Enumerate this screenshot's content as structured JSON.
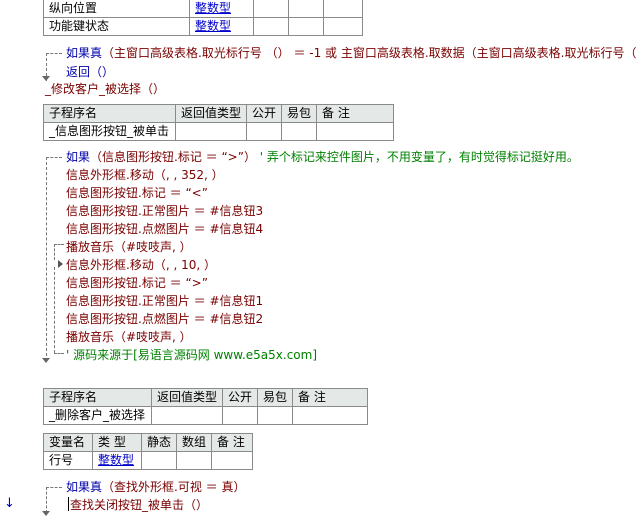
{
  "table_top": {
    "rows": [
      {
        "name": "纵向位置",
        "type": "整数型"
      },
      {
        "name": "功能键状态",
        "type": "整数型"
      }
    ]
  },
  "code1": {
    "if_kw": "如果真",
    "if_cond": "（主窗口高级表格.取光标行号 （） ＝ -1 或 主窗口高级表格.取数据（主窗口高级表格.取光标行号（",
    "ret": "返回（）",
    "sub_name": "_修改客户_被选择（）"
  },
  "sub_table_1": {
    "headers": [
      "子程序名",
      "返回值类型",
      "公开",
      "易包",
      "备 注"
    ],
    "name": "_信息图形按钮_被单击"
  },
  "code2": {
    "if_kw": "如果",
    "if_cond": "（信息图形按钮.标记 ＝ “>”）",
    "comment": "' 弄个标记来控件图片，不用变量了，有时觉得标记挺好用。",
    "lines_a": [
      "信息外形框.移动（, , 352, ）",
      "信息图形按钮.标记 ＝ “<”",
      "信息图形按钮.正常图片 ＝ #信息钮3",
      "信息图形按钮.点燃图片 ＝ #信息钮4"
    ],
    "play_a": "播放音乐（#吱吱声, ）",
    "lines_b": [
      "信息外形框.移动（, , 10, ）",
      "信息图形按钮.标记 ＝ “>”",
      "信息图形按钮.正常图片 ＝ #信息钮1",
      "信息图形按钮.点燃图片 ＝ #信息钮2"
    ],
    "play_b": "播放音乐（#吱吱声, ）",
    "source": "' 源码来源于[易语言源码网 www.e5a5x.com]"
  },
  "sub_table_2": {
    "headers": [
      "子程序名",
      "返回值类型",
      "公开",
      "易包",
      "备 注"
    ],
    "name": "_删除客户_被选择"
  },
  "var_table": {
    "headers": [
      "变量名",
      "类 型",
      "静态",
      "数组",
      "备 注"
    ],
    "name": "行号",
    "type": "整数型"
  },
  "code3": {
    "if_kw": "如果真",
    "if_cond": "（查找外形框.可视 ＝ 真）",
    "call": "查找关闭按钮_被单击（）"
  },
  "gutter": {
    "arrow": "↓"
  }
}
